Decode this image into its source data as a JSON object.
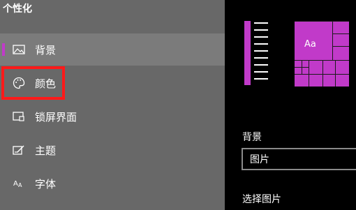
{
  "sidebar": {
    "title": "个性化",
    "items": [
      {
        "label": "背景",
        "icon": "picture-icon"
      },
      {
        "label": "颜色",
        "icon": "palette-icon"
      },
      {
        "label": "锁屏界面",
        "icon": "lock-screen-icon"
      },
      {
        "label": "主题",
        "icon": "theme-icon"
      },
      {
        "label": "字体",
        "icon": "font-icon"
      }
    ],
    "selected_index": 0
  },
  "preview": {
    "tile_text": "Aa"
  },
  "main": {
    "background_heading": "背景",
    "background_value": "图片",
    "choose_picture_heading": "选择图片"
  },
  "colors": {
    "accent": "#c13ac9",
    "highlight": "#ff1a1a"
  }
}
